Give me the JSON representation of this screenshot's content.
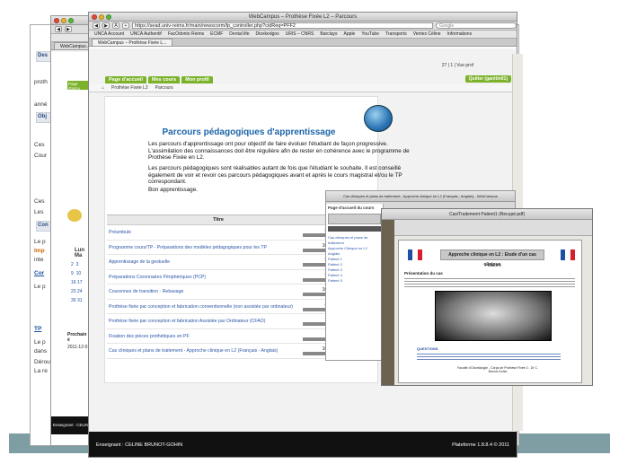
{
  "back_window": {
    "side_labels": [
      "Des",
      "proth",
      "anné",
      "Obj",
      "Ces",
      "Cour",
      "Ces",
      "Les",
      "Lun",
      "Ma",
      "Con",
      "Le p",
      "TP",
      "Le p",
      "dans",
      "Dérou",
      "La re"
    ],
    "calendar_rows": [
      "2",
      "9",
      "16",
      "23",
      "30"
    ],
    "calendar_rows2": [
      "3",
      "10",
      "17",
      "24",
      "31"
    ],
    "prochain": "Prochain é",
    "date": "2011-12-0",
    "footer_label": "Enseignant : CELIN"
  },
  "mid_window": {
    "title": "WebCampus – Prothèse Fixée L2 – Parcours",
    "url": "https://sead.univ-reims.fr/main/newscorm/lp_controller.php?cidReq=PFF2",
    "search_placeholder": "Google",
    "bookmarks": [
      "UNCA Account",
      "UNCA Authentif",
      "FacOdonto Reims",
      "ECMF",
      "Dental life",
      "Dioxkedgos",
      "URIS – CNRS",
      "Barclays",
      "Apple",
      "YouTube",
      "Transports",
      "Ventes Céline",
      "Informations"
    ],
    "tabs": [
      "WebCampus – Prothèse Fixée L...",
      "WebCampus..."
    ]
  },
  "main_window": {
    "nav_tabs": [
      "Page d'accueil",
      "Mes cours",
      "Mon profil"
    ],
    "quit_button": "Quitter (garétin01)",
    "status": "27 | 1 | Vue prof",
    "breadcrumb": [
      "Prothèse Fixée L2",
      "Parcours"
    ],
    "heading": "Parcours pédagogiques d'apprentissage",
    "paragraphs": [
      "Les parcours d'apprentissage ont pour objectif de faire évoluer l'étudiant de façon progressive. L'assimilation des connaissances doit être régulière afin de rester en cohérence avec le programme de Prothèse Fixée en L2.",
      "Les parcours pédagogiques sont réalisables autant de fois que l'étudiant le souhaite. Il est conseillé également de voir et revoir ces parcours pédagogiques avant et après le cours magistral et/ou le TP correspondant.",
      "Bon apprentissage."
    ],
    "table_header": "Titre",
    "rows": [
      {
        "title": "Préambule",
        "value": "83"
      },
      {
        "title": "Programme cours/TP - Préparations des modèles pédagogiques pour les TP",
        "value": "100"
      },
      {
        "title": "Apprentissage de la gestuelle",
        "value": "90"
      },
      {
        "title": "Préparations Coronnaires Périphériques (PCP)",
        "value": "91"
      },
      {
        "title": "Couronnes de transition - Rebasage",
        "value": "100"
      },
      {
        "title": "Prothèse fixée par conception et fabrication conventionnelle (non assistée par ordinateur)",
        "value": "88"
      },
      {
        "title": "Prothèse fixée par conception et fabrication Assistée par Ordinateur (CFAO)",
        "value": "78"
      },
      {
        "title": "Fixation des pièces prothétiques en PF",
        "value": "0"
      },
      {
        "title": "Cas cliniques et plans de traitement - Approche clinique en L2 (Français - Anglais)",
        "value": "100"
      }
    ],
    "footer_left": "Enseignant : CELINE BRUNOT-GOHIN",
    "footer_right": "Plateforme 1.8.8.4 © 2011"
  },
  "presentation_window": {
    "title": "Cas cliniques et plans de traitement - Approche clinique en L2 (Français - Anglais) - WebCampus",
    "left_title": "Page d'accueil du cours",
    "items": [
      "Cas cliniques et plans de traitement",
      "Approche Clinique en L2",
      "Anglais",
      "Patient 1",
      "Patient 2",
      "Patient 3",
      "Patient 4",
      "Patient 5"
    ]
  },
  "image_window": {
    "title": "Cas/Traitement Patient1 (Recupé.pdf)",
    "header": "Approche clinique en L2 : Etude d'un cas clinique",
    "patient": "Patient 3",
    "section": "Présentation du cas",
    "question_label": "QUESTIONS",
    "footer": "Faculté d'Odontologie - Corps de Prothèse Fixée 2 - Dr C. Brunot-Gohin"
  }
}
